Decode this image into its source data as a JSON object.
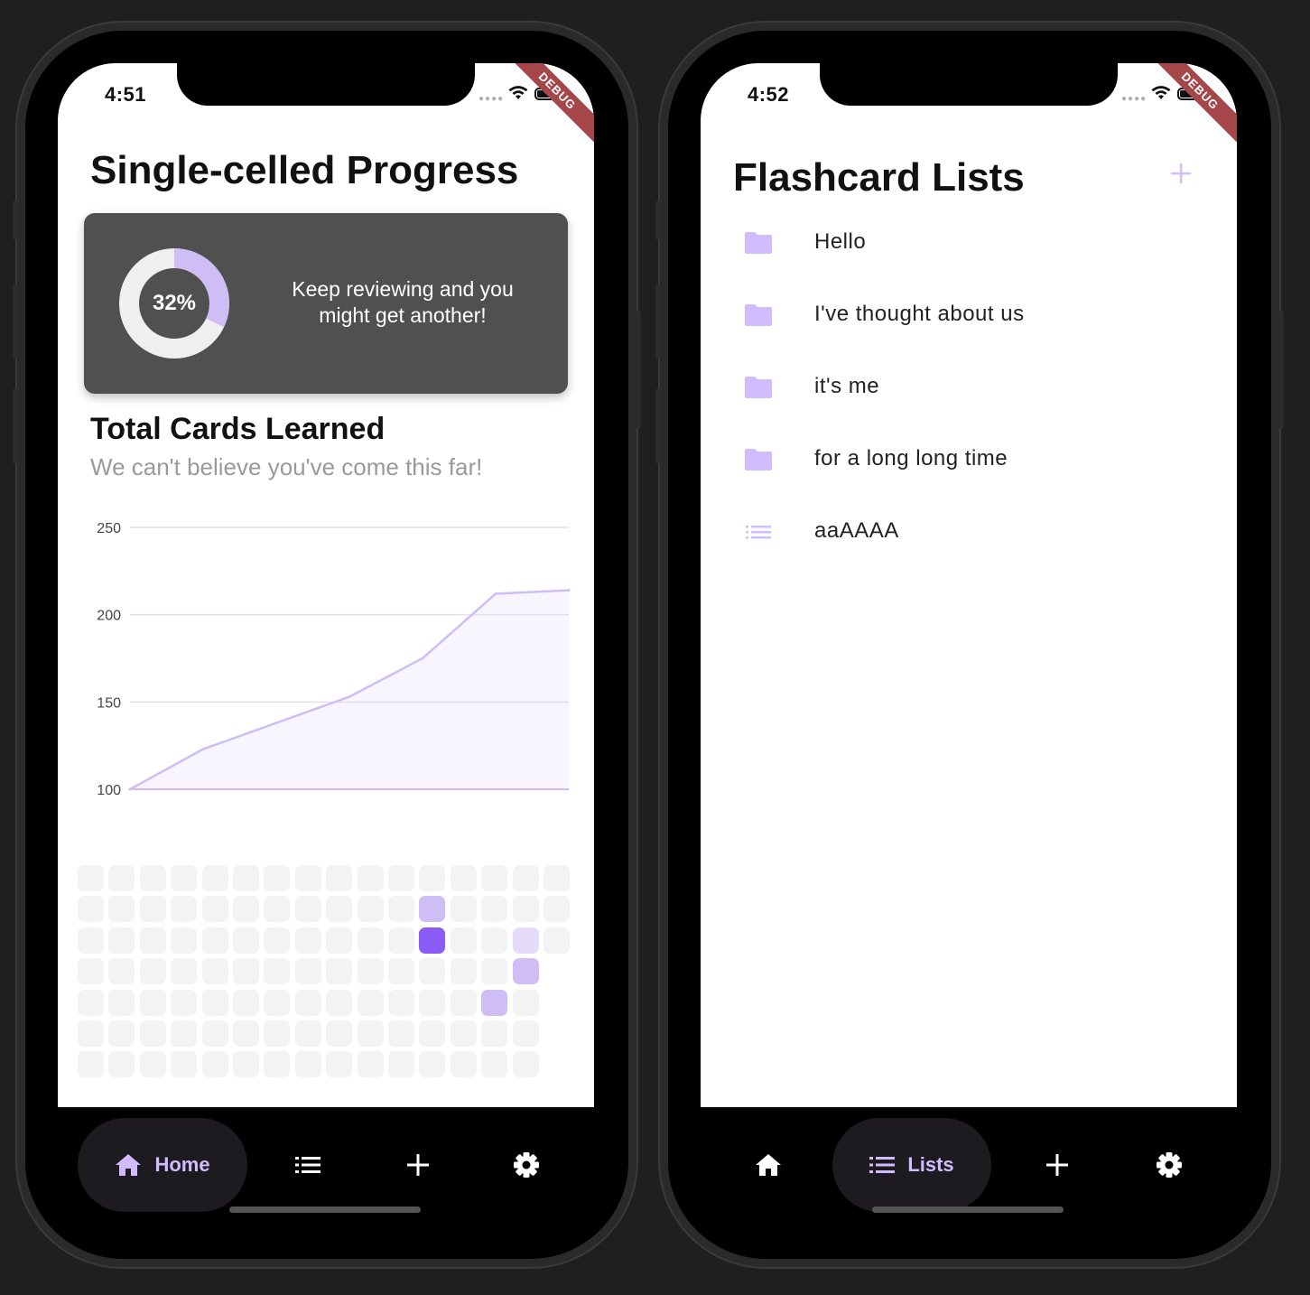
{
  "left_phone": {
    "status": {
      "time": "4:51",
      "debug_banner": "DEBUG"
    },
    "title": "Single-celled Progress",
    "progress_card": {
      "percent_label": "32%",
      "percent_value": 0.32,
      "message": "Keep reviewing and you might get another!"
    },
    "section": {
      "title": "Total Cards Learned",
      "subtitle": "We can't believe you've come this far!"
    },
    "chart_data": {
      "type": "area",
      "title": "",
      "xlabel": "",
      "ylabel": "",
      "ylim": [
        100,
        250
      ],
      "yticks": [
        "250",
        "200",
        "150",
        "100"
      ],
      "grid": true,
      "x": [
        0,
        1,
        2,
        3,
        4,
        5,
        6
      ],
      "values": [
        100,
        123,
        138,
        153,
        175,
        212,
        214
      ],
      "color": "#cfbdf6"
    },
    "heatmap": {
      "rows": 7,
      "cols": 16,
      "highlights": [
        {
          "row": 1,
          "col": 11,
          "level": 2
        },
        {
          "row": 2,
          "col": 11,
          "level": 4
        },
        {
          "row": 2,
          "col": 14,
          "level": 1
        },
        {
          "row": 3,
          "col": 14,
          "level": 2
        },
        {
          "row": 4,
          "col": 13,
          "level": 2
        }
      ],
      "visible_cols_by_row": [
        16,
        16,
        16,
        15,
        15,
        15,
        15
      ]
    },
    "nav": {
      "active": "Home",
      "home_label": "Home"
    }
  },
  "right_phone": {
    "status": {
      "time": "4:52",
      "debug_banner": "DEBUG"
    },
    "title": "Flashcard Lists",
    "add_icon": "plus-icon",
    "lists": [
      {
        "label": "Hello",
        "icon": "folder-icon"
      },
      {
        "label": "I've thought about us",
        "icon": "folder-icon"
      },
      {
        "label": "it's me",
        "icon": "folder-icon"
      },
      {
        "label": "for a long long time",
        "icon": "folder-icon"
      },
      {
        "label": "aaAAAA",
        "icon": "list-icon"
      }
    ],
    "nav": {
      "active": "Lists",
      "lists_label": "Lists"
    }
  },
  "colors": {
    "accent": "#d0bcff",
    "accent_strong": "#8b5cf6",
    "card_bg": "#505050",
    "nav_pill": "#1d1b20"
  }
}
